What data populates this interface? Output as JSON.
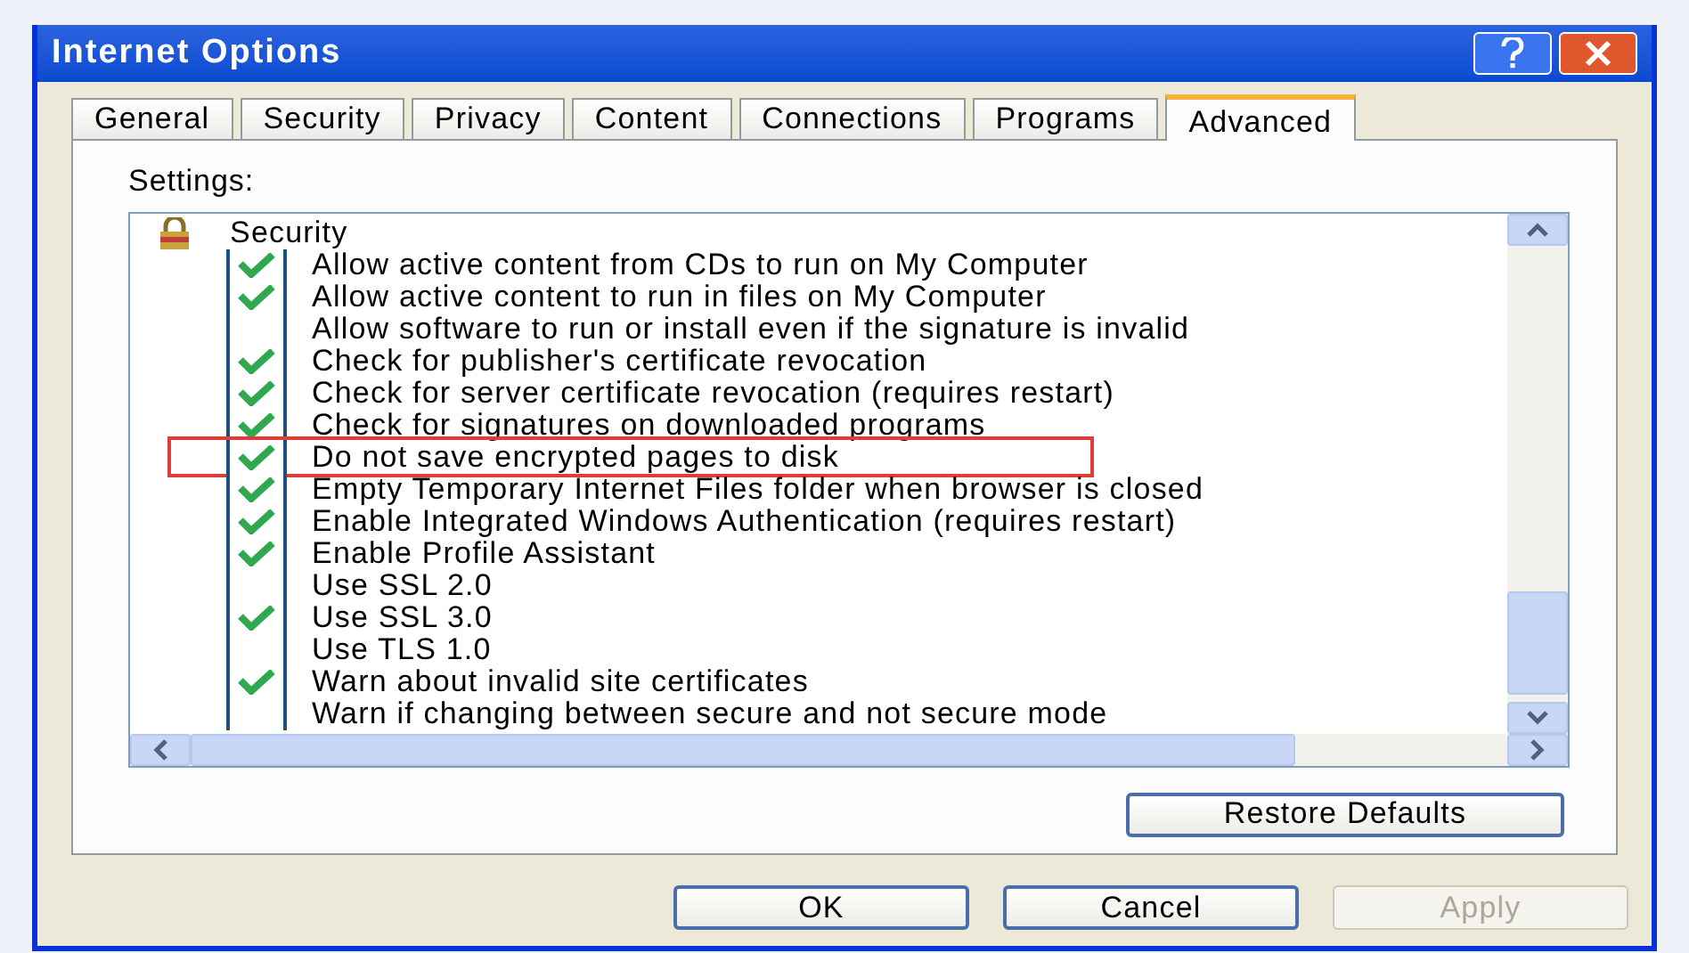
{
  "window": {
    "title": "Internet Options"
  },
  "tabs": [
    {
      "label": "General",
      "selected": false
    },
    {
      "label": "Security",
      "selected": false
    },
    {
      "label": "Privacy",
      "selected": false
    },
    {
      "label": "Content",
      "selected": false
    },
    {
      "label": "Connections",
      "selected": false
    },
    {
      "label": "Programs",
      "selected": false
    },
    {
      "label": "Advanced",
      "selected": true
    }
  ],
  "settings_label": "Settings:",
  "settings": [
    {
      "kind": "category",
      "label": "Security"
    },
    {
      "kind": "checkbox",
      "label": "Allow active content from CDs to run on My Computer",
      "checked": true,
      "highlighted": false
    },
    {
      "kind": "checkbox",
      "label": "Allow active content to run in files on My Computer",
      "checked": true,
      "highlighted": false
    },
    {
      "kind": "checkbox",
      "label": "Allow software to run or install even if the signature is invalid",
      "checked": false,
      "highlighted": false
    },
    {
      "kind": "checkbox",
      "label": "Check for publisher's certificate revocation",
      "checked": true,
      "highlighted": false
    },
    {
      "kind": "checkbox",
      "label": "Check for server certificate revocation (requires restart)",
      "checked": true,
      "highlighted": false
    },
    {
      "kind": "checkbox",
      "label": "Check for signatures on downloaded programs",
      "checked": true,
      "highlighted": false
    },
    {
      "kind": "checkbox",
      "label": "Do not save encrypted pages to disk",
      "checked": true,
      "highlighted": true
    },
    {
      "kind": "checkbox",
      "label": "Empty Temporary Internet Files folder when browser is closed",
      "checked": true,
      "highlighted": false
    },
    {
      "kind": "checkbox",
      "label": "Enable Integrated Windows Authentication (requires restart)",
      "checked": true,
      "highlighted": false
    },
    {
      "kind": "checkbox",
      "label": "Enable Profile Assistant",
      "checked": true,
      "highlighted": false
    },
    {
      "kind": "checkbox",
      "label": "Use SSL 2.0",
      "checked": false,
      "highlighted": false
    },
    {
      "kind": "checkbox",
      "label": "Use SSL 3.0",
      "checked": true,
      "highlighted": false
    },
    {
      "kind": "checkbox",
      "label": "Use TLS 1.0",
      "checked": false,
      "highlighted": false
    },
    {
      "kind": "checkbox",
      "label": "Warn about invalid site certificates",
      "checked": true,
      "highlighted": false
    },
    {
      "kind": "checkbox",
      "label": "Warn if changing between secure and not secure mode",
      "checked": false,
      "highlighted": false
    }
  ],
  "restore_button": "Restore Defaults",
  "buttons": [
    {
      "label": "OK",
      "disabled": false
    },
    {
      "label": "Cancel",
      "disabled": false
    },
    {
      "label": "Apply",
      "disabled": true
    }
  ]
}
